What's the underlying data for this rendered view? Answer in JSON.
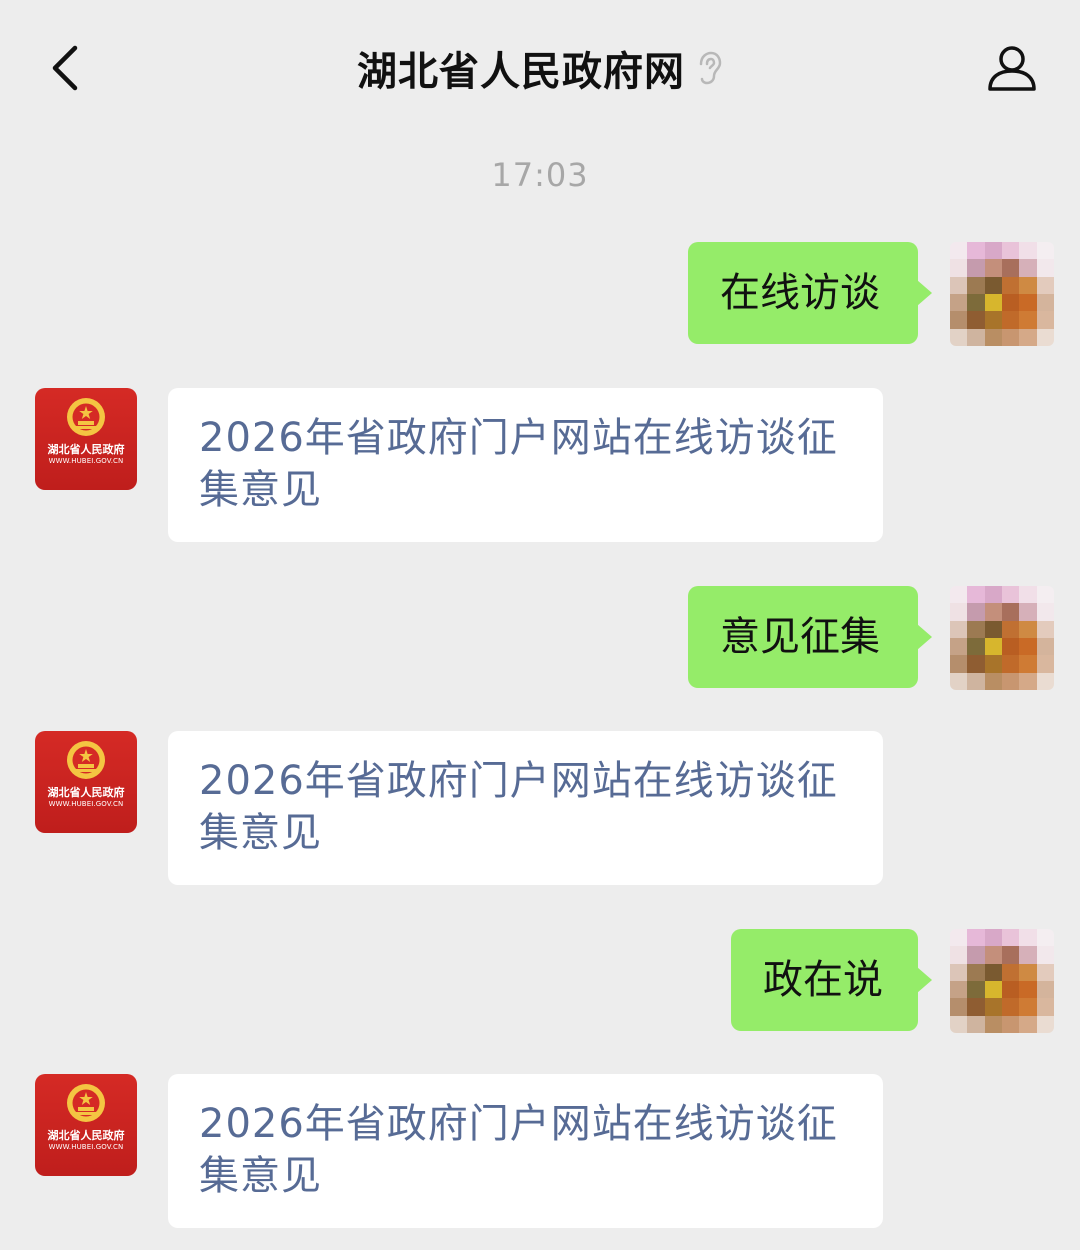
{
  "header": {
    "title": "湖北省人民政府网",
    "back_icon": "chevron-left-icon",
    "ear_icon": "ear-icon",
    "profile_icon": "person-icon"
  },
  "timestamp": "17:03",
  "messages": [
    {
      "from": "me",
      "text": "在线访谈"
    },
    {
      "from": "gov",
      "text": "2026年省政府门户网站在线访谈征集意见",
      "logo_text": "湖北省人民政府",
      "logo_url": "WWW.HUBEI.GOV.CN"
    },
    {
      "from": "me",
      "text": "意见征集"
    },
    {
      "from": "gov",
      "text": "2026年省政府门户网站在线访谈征集意见",
      "logo_text": "湖北省人民政府",
      "logo_url": "WWW.HUBEI.GOV.CN"
    },
    {
      "from": "me",
      "text": "政在说"
    },
    {
      "from": "gov",
      "text": "2026年省政府门户网站在线访谈征集意见",
      "logo_text": "湖北省人民政府",
      "logo_url": "WWW.HUBEI.GOV.CN"
    }
  ],
  "colors": {
    "background": "#ededed",
    "bubble_out": "#95ec69",
    "bubble_in": "#ffffff",
    "link_text": "#576b95",
    "gov_red": "#d52a25"
  }
}
